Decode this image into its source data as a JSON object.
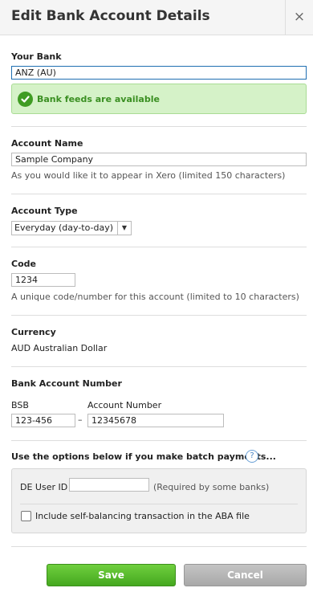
{
  "header": {
    "title": "Edit Bank Account Details",
    "close_glyph": "×"
  },
  "your_bank": {
    "label": "Your Bank",
    "value": "ANZ (AU)"
  },
  "bank_feeds": {
    "message": "Bank feeds are available",
    "icon": "check-circle-icon",
    "color": "#3f9c23"
  },
  "account_name": {
    "label": "Account Name",
    "value": "Sample Company",
    "hint": "As you would like it to appear in Xero (limited 150 characters)"
  },
  "account_type": {
    "label": "Account Type",
    "selected": "Everyday (day-to-day)"
  },
  "code": {
    "label": "Code",
    "value": "1234",
    "hint": "A unique code/number for this account (limited to 10 characters)"
  },
  "currency": {
    "label": "Currency",
    "value": "AUD Australian Dollar"
  },
  "bank_account_number": {
    "label": "Bank Account Number",
    "bsb_label": "BSB",
    "bsb_value": "123-456",
    "separator": "–",
    "account_number_label": "Account Number",
    "account_number_value": "12345678"
  },
  "batch": {
    "title": "Use the options below if you make batch payments...",
    "help_glyph": "?",
    "de_user_id_label": "DE User ID",
    "de_user_id_value": "",
    "de_user_id_hint": "(Required by some banks)",
    "self_balancing_label": "Include self-balancing transaction in the ABA file",
    "self_balancing_checked": false
  },
  "actions": {
    "save_label": "Save",
    "cancel_label": "Cancel"
  }
}
